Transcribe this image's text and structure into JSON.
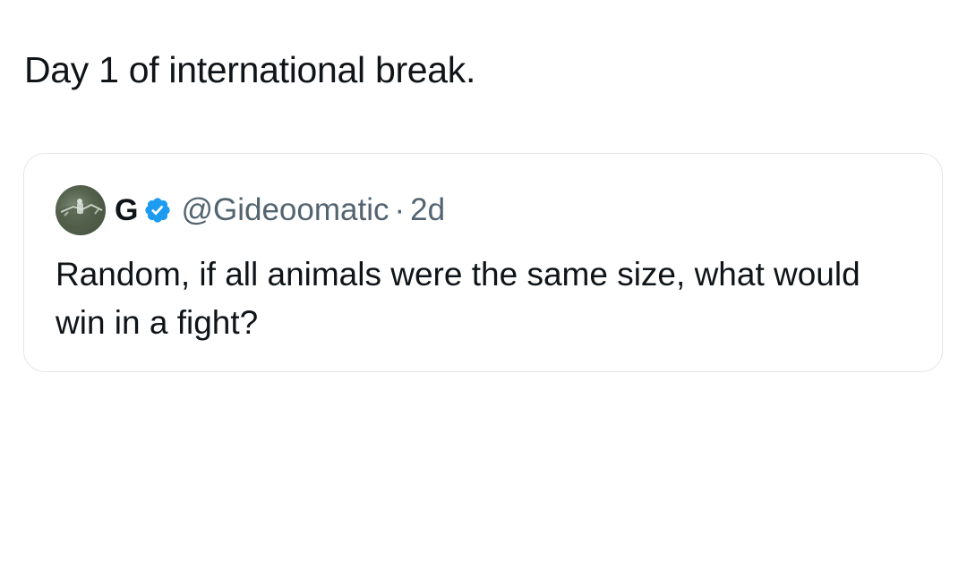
{
  "tweet": {
    "text": "Day 1 of international break."
  },
  "quoted_tweet": {
    "author": {
      "display_name": "G",
      "handle": "@Gideoomatic",
      "verified": true,
      "verified_badge_color": "#1d9bf0",
      "avatar_icon": "profile-photo"
    },
    "separator": "·",
    "time": "2d",
    "text": "Random, if all animals were the same size, what would win in a fight?"
  },
  "colors": {
    "text_primary": "#0f1419",
    "text_secondary": "#536471",
    "card_border": "#e3e6ea",
    "verified": "#1d9bf0"
  }
}
